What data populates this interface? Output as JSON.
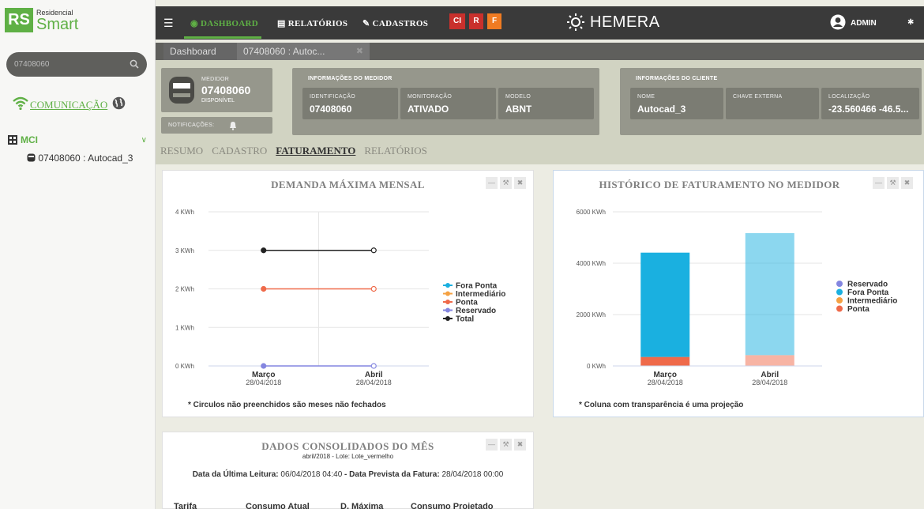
{
  "sidebar": {
    "logo": {
      "badge": "RS",
      "line1": "Residencial",
      "line2": "Smart"
    },
    "search": {
      "value": "07408060",
      "placeholder": "07408060"
    },
    "comunicacao": "COMUNICAÇÃO",
    "group": "MCI",
    "meter_item": "07408060 : Autocad_3"
  },
  "topbar": {
    "dashboard": "DASHBOARD",
    "relatorios": "RELATÓRIOS",
    "cadastros": "CADASTROS",
    "quick": [
      "CI",
      "R",
      "F"
    ],
    "brand": "HEMERA",
    "user": "ADMIN"
  },
  "tabs": [
    "Dashboard",
    "07408060 : Autoc..."
  ],
  "meter": {
    "caption": "MEDIDOR",
    "id": "07408060",
    "status": "DISPONÍVEL",
    "notifications": "NOTIFICAÇÕES:"
  },
  "medidor_info": {
    "title": "INFORMAÇÕES DO MEDIDOR",
    "fields": [
      {
        "label": "IDENTIFICAÇÃO",
        "value": "07408060"
      },
      {
        "label": "MONITORAÇÃO",
        "value": "ATIVADO"
      },
      {
        "label": "MODELO",
        "value": "ABNT"
      }
    ]
  },
  "cliente_info": {
    "title": "INFORMAÇÕES DO CLIENTE",
    "fields": [
      {
        "label": "NOME",
        "value": "Autocad_3"
      },
      {
        "label": "CHAVE EXTERNA",
        "value": ""
      },
      {
        "label": "LOCALIZAÇÃO",
        "value": "-23.560466 -46.5..."
      }
    ]
  },
  "section_tabs": [
    "RESUMO",
    "CADASTRO",
    "FATURAMENTO",
    "RELATÓRIOS"
  ],
  "colors": {
    "green": "#5fb045",
    "fora_ponta": "#1ab0e0",
    "intermediario": "#f5a142",
    "ponta": "#ef6a4a",
    "reservado": "#8486e0",
    "total": "#222222"
  },
  "chart_data": [
    {
      "type": "line",
      "title": "DEMANDA MÁXIMA MENSAL",
      "categories": [
        "Março",
        "Abril"
      ],
      "dates": [
        "28/04/2018",
        "28/04/2018"
      ],
      "ylim": [
        0,
        4
      ],
      "yticks": [
        "0 KWh",
        "1 KWh",
        "2 KWh",
        "3 KWh",
        "4 KWh"
      ],
      "series": [
        {
          "name": "Fora Ponta",
          "values": [
            0,
            0
          ],
          "color": "#1ab0e0"
        },
        {
          "name": "Intermediário",
          "values": [
            0,
            0
          ],
          "color": "#f5a142"
        },
        {
          "name": "Ponta",
          "values": [
            2,
            2
          ],
          "color": "#ef6a4a"
        },
        {
          "name": "Reservado",
          "values": [
            0,
            0
          ],
          "color": "#8486e0"
        },
        {
          "name": "Total",
          "values": [
            3,
            3
          ],
          "color": "#222222"
        }
      ],
      "note": "* Circulos não preenchidos são meses não fechados",
      "legend": "right"
    },
    {
      "type": "bar",
      "title": "HISTÓRICO DE FATURAMENTO NO MEDIDOR",
      "categories": [
        "Março",
        "Abril"
      ],
      "dates": [
        "28/04/2018",
        "28/04/2018"
      ],
      "ylim": [
        0,
        6000
      ],
      "yticks": [
        "0 KWh",
        "2000 KWh",
        "4000 KWh",
        "6000 KWh"
      ],
      "stacked": true,
      "series": [
        {
          "name": "Reservado",
          "values": [
            0,
            0
          ],
          "color": "#8486e0"
        },
        {
          "name": "Fora Ponta",
          "values": [
            4060,
            4750
          ],
          "color": "#1ab0e0"
        },
        {
          "name": "Intermediário",
          "values": [
            0,
            0
          ],
          "color": "#f5a142"
        },
        {
          "name": "Ponta",
          "values": [
            350,
            420
          ],
          "color": "#ef6a4a"
        }
      ],
      "note": "* Coluna com transparência é uma projeção",
      "legend": "right"
    }
  ],
  "consolidado": {
    "title": "DADOS CONSOLIDADOS DO MÊS",
    "subtitle": "abril/2018 - Lote: Lote_vermelho",
    "line_label1": "Data da Última Leitura:",
    "line_value1": "06/04/2018 04:40",
    "line_label2": "- Data Prevista da Fatura:",
    "line_value2": "28/04/2018 00:00",
    "columns": [
      "Tarifa",
      "Consumo Atual",
      "D. Máxima",
      "Consumo Projetado"
    ]
  }
}
